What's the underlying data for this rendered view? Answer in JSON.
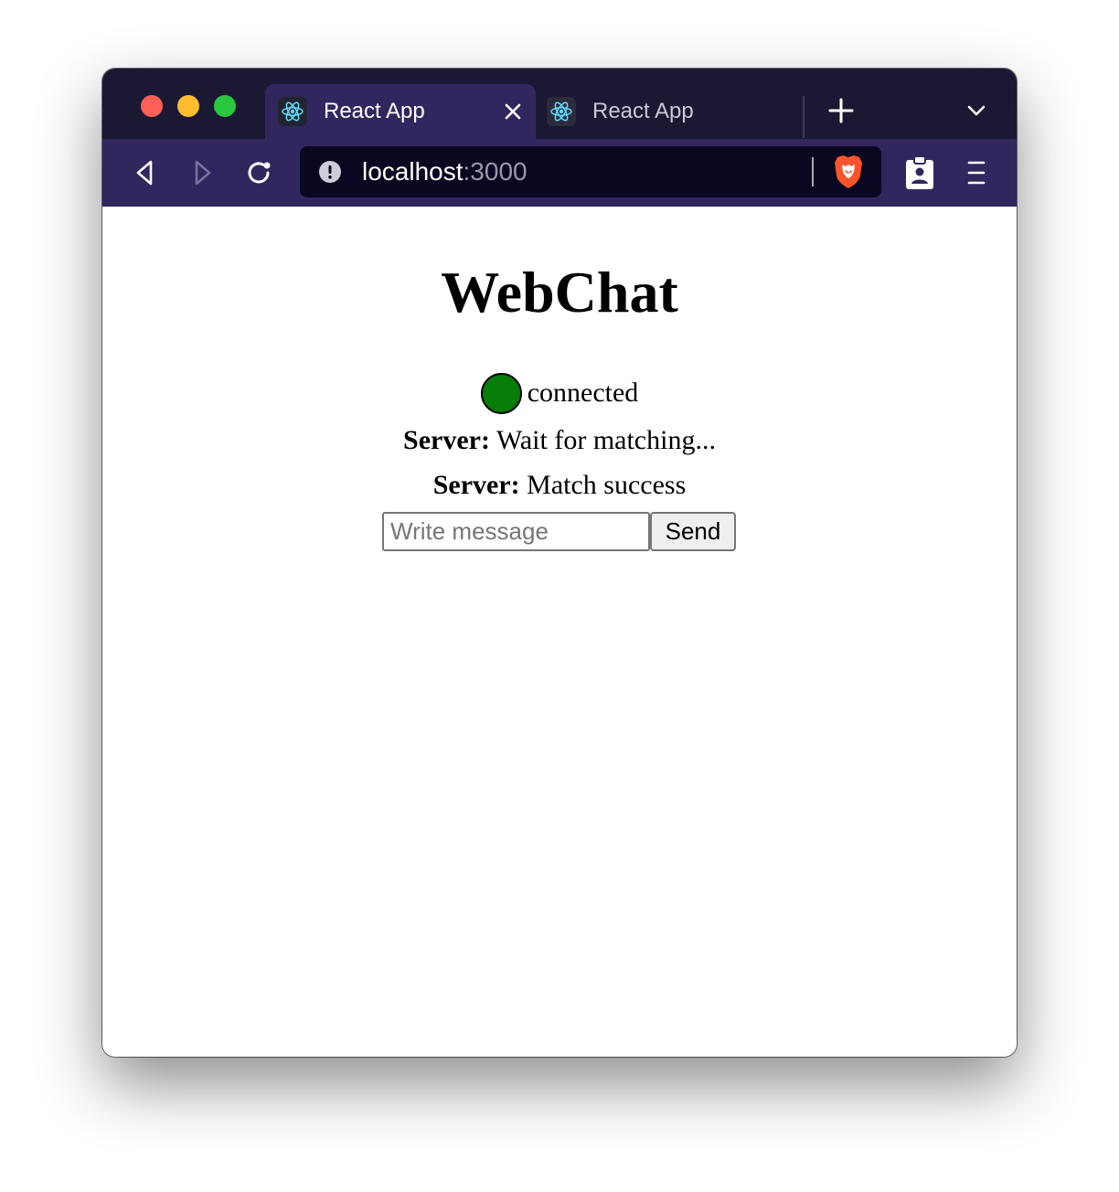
{
  "browser": {
    "tabs": [
      {
        "title": "React App",
        "active": true,
        "favicon": "react-atom-icon"
      },
      {
        "title": "React App",
        "active": false,
        "favicon": "react-atom-icon"
      }
    ],
    "url": {
      "host": "localhost",
      "port": ":3000"
    },
    "colors": {
      "tabstrip": "#1b1833",
      "toolbar": "#32265f",
      "urlbar": "#0a0820",
      "react_accent": "#61dafb",
      "brave_orange": "#fb542b"
    }
  },
  "app": {
    "title": "WebChat",
    "status": {
      "label": "connected",
      "color": "#067d06"
    },
    "messages": [
      {
        "sender": "Server:",
        "text": "Wait for matching..."
      },
      {
        "sender": "Server:",
        "text": "Match success"
      }
    ],
    "composer": {
      "placeholder": "Write message",
      "value": "",
      "send_label": "Send"
    }
  }
}
